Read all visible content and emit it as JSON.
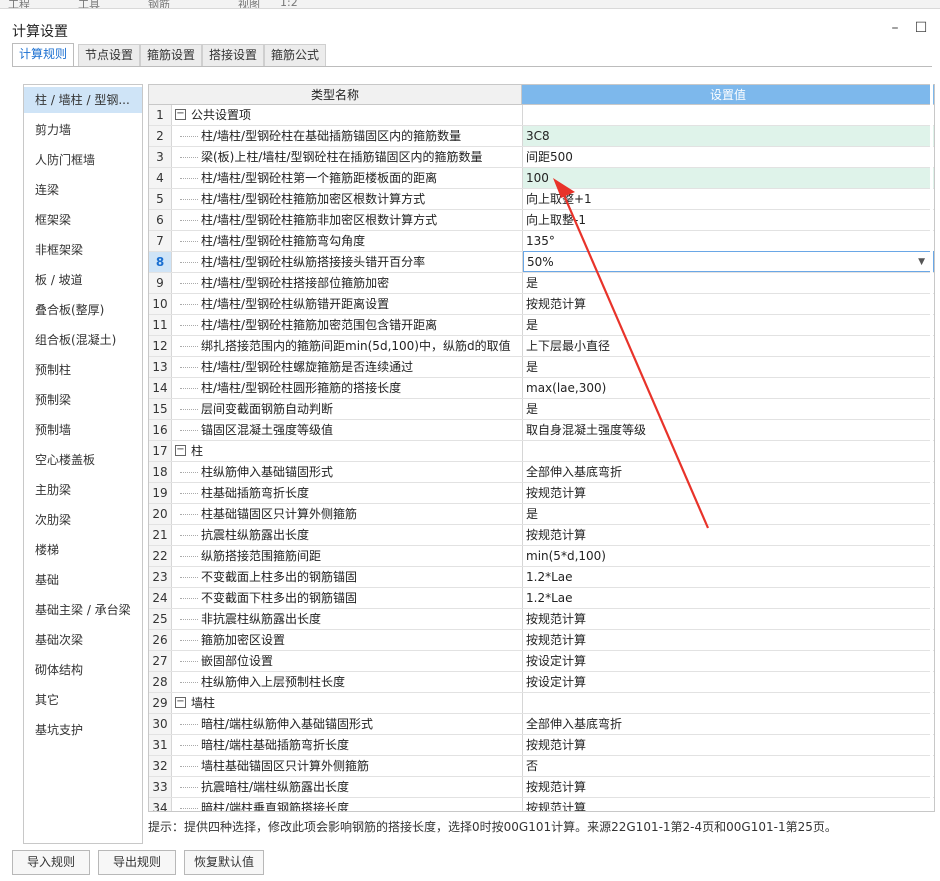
{
  "dialog": {
    "title": "计算设置",
    "minimize_glyph": "–",
    "maximize_glyph": "☐"
  },
  "tabs": [
    {
      "label": "计算规则",
      "active": true
    },
    {
      "label": "节点设置"
    },
    {
      "label": "箍筋设置"
    },
    {
      "label": "搭接设置"
    },
    {
      "label": "箍筋公式"
    }
  ],
  "sidebar": {
    "items": [
      "柱 / 墙柱 / 型钢...",
      "剪力墙",
      "人防门框墙",
      "连梁",
      "框架梁",
      "非框架梁",
      "板 / 坡道",
      "叠合板(整厚)",
      "组合板(混凝土)",
      "预制柱",
      "预制梁",
      "预制墙",
      "空心楼盖板",
      "主肋梁",
      "次肋梁",
      "楼梯",
      "基础",
      "基础主梁 / 承台梁",
      "基础次梁",
      "砌体结构",
      "其它",
      "基坑支护"
    ],
    "selected": 0
  },
  "grid": {
    "header_name": "类型名称",
    "header_value": "设置值",
    "active_row": "8",
    "rows": [
      {
        "n": "1",
        "name": "公共设置项",
        "value": "",
        "group": true
      },
      {
        "n": "2",
        "name": "柱/墙柱/型钢砼柱在基础插筋锚固区内的箍筋数量",
        "value": "3C8",
        "hl": true
      },
      {
        "n": "3",
        "name": "梁(板)上柱/墙柱/型钢砼柱在插筋锚固区内的箍筋数量",
        "value": "间距500"
      },
      {
        "n": "4",
        "name": "柱/墙柱/型钢砼柱第一个箍筋距楼板面的距离",
        "value": "100",
        "hl": true
      },
      {
        "n": "5",
        "name": "柱/墙柱/型钢砼柱箍筋加密区根数计算方式",
        "value": "向上取整+1"
      },
      {
        "n": "6",
        "name": "柱/墙柱/型钢砼柱箍筋非加密区根数计算方式",
        "value": "向上取整-1"
      },
      {
        "n": "7",
        "name": "柱/墙柱/型钢砼柱箍筋弯勾角度",
        "value": "135°"
      },
      {
        "n": "8",
        "name": "柱/墙柱/型钢砼柱纵筋搭接接头错开百分率",
        "value": "50%",
        "editing": true
      },
      {
        "n": "9",
        "name": "柱/墙柱/型钢砼柱搭接部位箍筋加密",
        "value": "是"
      },
      {
        "n": "10",
        "name": "柱/墙柱/型钢砼柱纵筋错开距离设置",
        "value": "按规范计算"
      },
      {
        "n": "11",
        "name": "柱/墙柱/型钢砼柱箍筋加密范围包含错开距离",
        "value": "是"
      },
      {
        "n": "12",
        "name": "绑扎搭接范围内的箍筋间距min(5d,100)中，纵筋d的取值",
        "value": "上下层最小直径"
      },
      {
        "n": "13",
        "name": "柱/墙柱/型钢砼柱螺旋箍筋是否连续通过",
        "value": "是"
      },
      {
        "n": "14",
        "name": "柱/墙柱/型钢砼柱圆形箍筋的搭接长度",
        "value": "max(lae,300)"
      },
      {
        "n": "15",
        "name": "层间变截面钢筋自动判断",
        "value": "是"
      },
      {
        "n": "16",
        "name": "锚固区混凝土强度等级值",
        "value": "取自身混凝土强度等级"
      },
      {
        "n": "17",
        "name": "柱",
        "value": "",
        "group": true
      },
      {
        "n": "18",
        "name": "柱纵筋伸入基础锚固形式",
        "value": "全部伸入基底弯折"
      },
      {
        "n": "19",
        "name": "柱基础插筋弯折长度",
        "value": "按规范计算"
      },
      {
        "n": "20",
        "name": "柱基础锚固区只计算外侧箍筋",
        "value": "是"
      },
      {
        "n": "21",
        "name": "抗震柱纵筋露出长度",
        "value": "按规范计算"
      },
      {
        "n": "22",
        "name": "纵筋搭接范围箍筋间距",
        "value": "min(5*d,100)"
      },
      {
        "n": "23",
        "name": "不变截面上柱多出的钢筋锚固",
        "value": "1.2*Lae"
      },
      {
        "n": "24",
        "name": "不变截面下柱多出的钢筋锚固",
        "value": "1.2*Lae"
      },
      {
        "n": "25",
        "name": "非抗震柱纵筋露出长度",
        "value": "按规范计算"
      },
      {
        "n": "26",
        "name": "箍筋加密区设置",
        "value": "按规范计算"
      },
      {
        "n": "27",
        "name": "嵌固部位设置",
        "value": "按设定计算"
      },
      {
        "n": "28",
        "name": "柱纵筋伸入上层预制柱长度",
        "value": "按设定计算"
      },
      {
        "n": "29",
        "name": "墙柱",
        "value": "",
        "group": true
      },
      {
        "n": "30",
        "name": "暗柱/端柱纵筋伸入基础锚固形式",
        "value": "全部伸入基底弯折"
      },
      {
        "n": "31",
        "name": "暗柱/端柱基础插筋弯折长度",
        "value": "按规范计算"
      },
      {
        "n": "32",
        "name": "墙柱基础锚固区只计算外侧箍筋",
        "value": "否"
      },
      {
        "n": "33",
        "name": "抗震暗柱/端柱纵筋露出长度",
        "value": "按规范计算"
      },
      {
        "n": "34",
        "name": "暗柱/端柱垂直钢筋搭接长度",
        "value": "按规范计算"
      }
    ]
  },
  "hint": "提示：提供四种选择，修改此项会影响钢筋的搭接长度，选择0时按00G101计算。来源22G101-1第2-4页和00G101-1第25页。",
  "buttons": {
    "import": "导入规则",
    "export": "导出规则",
    "restore": "恢复默认值"
  },
  "colors": {
    "accent": "#1a6fd1",
    "header_value_bg": "#7db8ec",
    "highlight_cell": "#dff3ea",
    "arrow": "#e8332a"
  },
  "icons": {
    "expander": "minus-box-icon",
    "dropdown": "triangle-down-icon",
    "annotation": "red-arrow"
  }
}
